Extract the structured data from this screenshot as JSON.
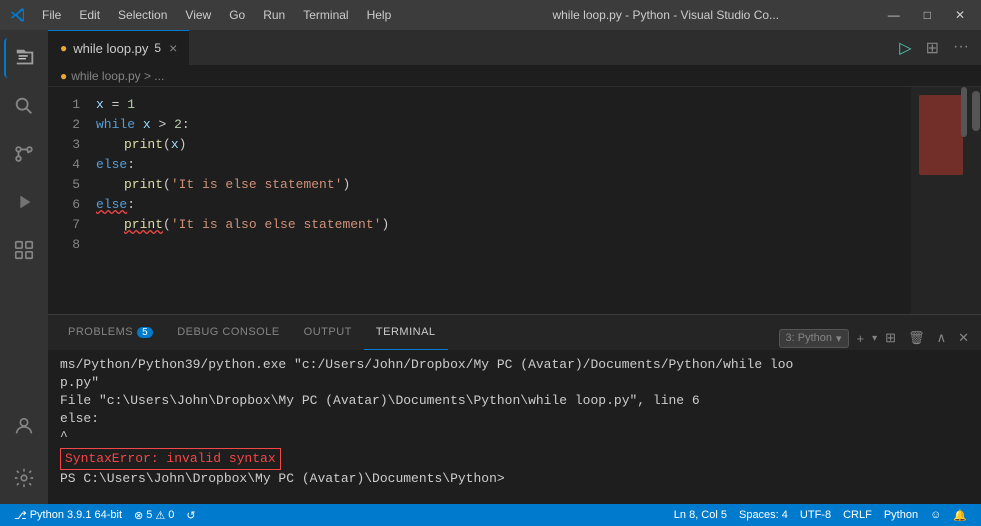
{
  "titlebar": {
    "menu_items": [
      "File",
      "Edit",
      "Selection",
      "View",
      "Go",
      "Run",
      "Terminal",
      "Help"
    ],
    "title": "while loop.py - Python - Visual Studio Co...",
    "controls": [
      "—",
      "□",
      "✕"
    ]
  },
  "tab": {
    "filename": "while loop.py",
    "modified_indicator": "5",
    "close_label": "×"
  },
  "breadcrumb": {
    "path": "while loop.py > ..."
  },
  "code": {
    "lines": [
      {
        "num": "1",
        "content_raw": "x = 1"
      },
      {
        "num": "2",
        "content_raw": "while x > 2:"
      },
      {
        "num": "3",
        "content_raw": "    print(x)"
      },
      {
        "num": "4",
        "content_raw": "else:"
      },
      {
        "num": "5",
        "content_raw": "    print('It is else statement')"
      },
      {
        "num": "6",
        "content_raw": "else:"
      },
      {
        "num": "7",
        "content_raw": "    print('It is also else statement')"
      },
      {
        "num": "8",
        "content_raw": ""
      }
    ]
  },
  "panel": {
    "tabs": [
      "PROBLEMS",
      "DEBUG CONSOLE",
      "OUTPUT",
      "TERMINAL"
    ],
    "active_tab": "TERMINAL",
    "problems_badge": "5",
    "terminal_name": "3: Python",
    "terminal_output": [
      "ms/Python/Python39/python.exe \"c:/Users/John/Dropbox/My PC (Avatar)/Documents/Python/while loo",
      "p.py\"",
      "  File \"c:\\Users\\John\\Dropbox\\My PC (Avatar)\\Documents\\Python\\while loop.py\", line 6",
      "    else:",
      "       ^",
      "SyntaxError: invalid syntax",
      "PS C:\\Users\\John\\Dropbox\\My PC (Avatar)\\Documents\\Python>"
    ],
    "error_line": "SyntaxError: invalid syntax",
    "add_terminal": "+",
    "split_terminal": "⊞",
    "kill_terminal": "🗑",
    "maximize": "^",
    "close": "✕"
  },
  "statusbar": {
    "python_version": "Python 3.9.1 64-bit",
    "errors_icon": "⊗",
    "errors_count": "5",
    "warnings_icon": "⚠",
    "warnings_count": "0",
    "sync_icon": "↺",
    "cursor_position": "Ln 8, Col 5",
    "spaces": "Spaces: 4",
    "encoding": "UTF-8",
    "line_ending": "CRLF",
    "language": "Python",
    "notifications": "🔔",
    "feedback": "☺"
  },
  "activity_bar": {
    "items": [
      {
        "icon": "files",
        "label": "Explorer"
      },
      {
        "icon": "search",
        "label": "Search"
      },
      {
        "icon": "source-control",
        "label": "Source Control"
      },
      {
        "icon": "run",
        "label": "Run and Debug"
      },
      {
        "icon": "extensions",
        "label": "Extensions"
      },
      {
        "icon": "account",
        "label": "Account"
      },
      {
        "icon": "settings",
        "label": "Settings"
      }
    ]
  }
}
